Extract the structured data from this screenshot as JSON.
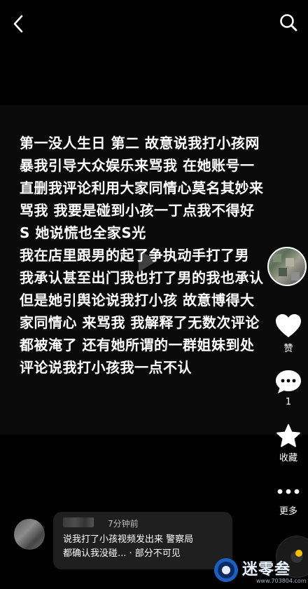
{
  "video": {
    "caption_text": "第一没人生日 第二 故意说我打小孩网\n暴我引导大众娱乐来骂我  在她账号一\n直删我评论利用大家同情心莫名其妙来\n骂我  我要是碰到小孩一丁点我不得好\nS 她说慌也全家S光\n我在店里跟男的起了争执动手打了男\n我承认甚至出门我也打了男的我也承认\n但是她引舆论说我打小孩 故意博得大\n家同情心 来骂我 我解释了无数次评论\n都被淹了 还有她所谓的一群姐妹到处\n评论说我打小孩我一点不认"
  },
  "top_bar": {
    "back_icon": "chevron-left-icon",
    "search_icon": "search-icon"
  },
  "actions": {
    "like_label": "赞",
    "comment_count": "1",
    "favorite_label": "收藏",
    "more_label": "更多"
  },
  "comment": {
    "time": "7分钟前",
    "text": "说我打了小孩视频发出来 警察局\n都确认我没碰... · 部分不可见"
  },
  "watermark": {
    "name": "迷零叁",
    "url": "www.703804.com"
  },
  "colors": {
    "background": "#000000",
    "text": "#ffffff",
    "music_accent": "#f2c200"
  }
}
